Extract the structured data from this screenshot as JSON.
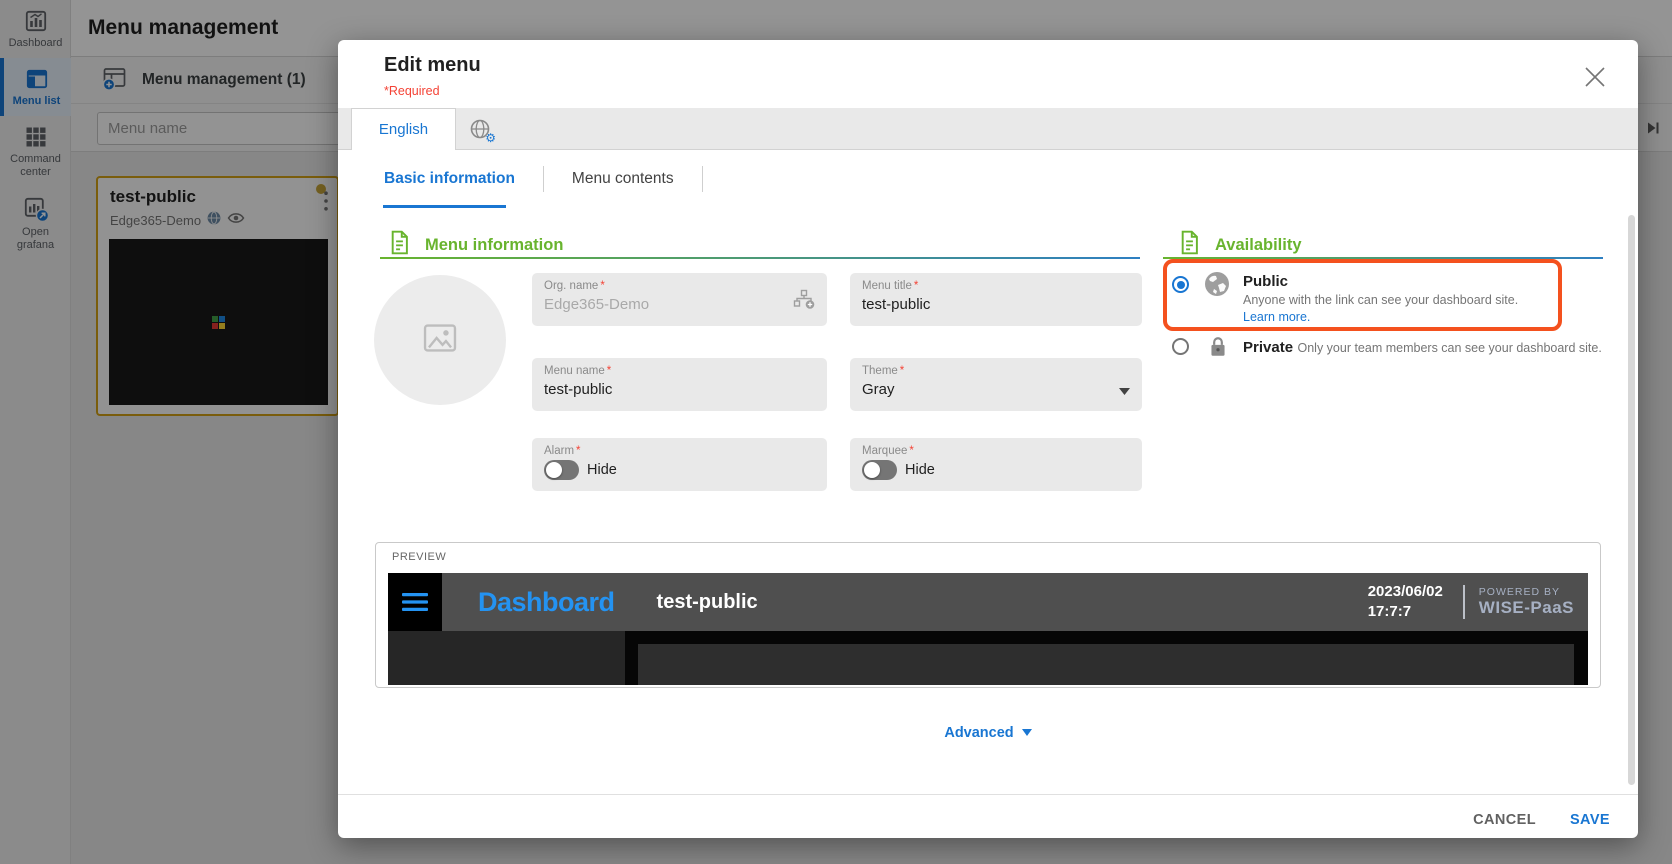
{
  "page": {
    "title": "Menu management",
    "section_title": "Menu management (1)",
    "search_placeholder": "Menu name"
  },
  "sidebar": {
    "items": [
      {
        "label": "Dashboard"
      },
      {
        "label": "Menu list",
        "active": true
      },
      {
        "label": "Command center"
      },
      {
        "label": "Open grafana"
      }
    ]
  },
  "card": {
    "title": "test-public",
    "org": "Edge365-Demo"
  },
  "modal": {
    "title": "Edit menu",
    "required_note": "*Required",
    "required_star": "*",
    "language_tab": "English",
    "tabs": [
      {
        "label": "Basic information",
        "active": true
      },
      {
        "label": "Menu contents",
        "active": false
      }
    ],
    "sections": {
      "menu_information": "Menu information",
      "availability": "Availability"
    },
    "fields": {
      "org_name": {
        "label": "Org. name",
        "value": "Edge365-Demo",
        "disabled": true
      },
      "menu_title": {
        "label": "Menu title",
        "value": "test-public"
      },
      "menu_name": {
        "label": "Menu name",
        "value": "test-public"
      },
      "theme": {
        "label": "Theme",
        "value": "Gray"
      },
      "alarm": {
        "label": "Alarm",
        "value": "Hide"
      },
      "marquee": {
        "label": "Marquee",
        "value": "Hide"
      }
    },
    "availability": {
      "public": {
        "label": "Public",
        "description": "Anyone with the link can see your dashboard site.",
        "link": "Learn more.",
        "selected": true
      },
      "private": {
        "label": "Private",
        "description": "Only your team members can see your dashboard site.",
        "selected": false
      }
    },
    "preview": {
      "label": "PREVIEW",
      "logo": "Dashboard",
      "menu_title": "test-public",
      "date": "2023/06/02",
      "time": "17:7:7",
      "powered_by": "POWERED BY",
      "brand": "WISE-PaaS"
    },
    "advanced_label": "Advanced",
    "cancel_label": "CANCEL",
    "save_label": "SAVE"
  },
  "colors": {
    "accent_blue": "#1976d2",
    "section_green": "#68b42e",
    "highlight_orange": "#f4511e",
    "required_red": "#f44336",
    "card_border_gold": "#d2a016",
    "preview_logo_blue": "#2493f2"
  }
}
